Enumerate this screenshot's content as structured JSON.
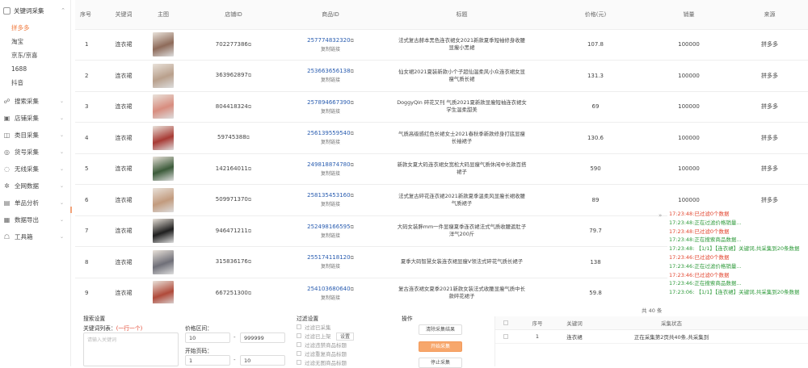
{
  "sidebar": {
    "head_label": "关键词采集",
    "subs": [
      "拼多多",
      "淘宝",
      "京东/京喜",
      "1688",
      "抖音"
    ],
    "active_sub": 0,
    "items": [
      {
        "label": "搜索采集",
        "icon": "☍"
      },
      {
        "label": "店铺采集",
        "icon": "▣"
      },
      {
        "label": "类目采集",
        "icon": "◫"
      },
      {
        "label": "货号采集",
        "icon": "◎"
      },
      {
        "label": "无线采集",
        "icon": "◌"
      },
      {
        "label": "全网数据",
        "icon": "✲"
      },
      {
        "label": "单品分析",
        "icon": "▤"
      },
      {
        "label": "数据导出",
        "icon": "▦"
      },
      {
        "label": "工具箱",
        "icon": "☖"
      }
    ]
  },
  "table": {
    "headers": [
      "序号",
      "关键词",
      "主图",
      "店铺ID",
      "商品ID",
      "标题",
      "价格(元)",
      "销量",
      "来源"
    ],
    "rows": [
      {
        "seq": "1",
        "keyword": "连衣裙",
        "shop_id": "702277386",
        "goods_id": "257774832320",
        "goods_sub": "复制链接",
        "title": "法式复古赫本黑色连衣裙女2021新款夏季短袖修身收腰显瘦小黑裙",
        "price": "107.8",
        "sales": "100000",
        "source": "拼多多",
        "thumb": "#8e6b5a"
      },
      {
        "seq": "2",
        "keyword": "连衣裙",
        "shop_id": "363962897",
        "goods_id": "253663656138",
        "goods_sub": "复制链接",
        "title": "仙女裙2021夏装新款小个子超仙温柔风小众连衣裙女显瘦气质长裙",
        "price": "131.3",
        "sales": "100000",
        "source": "拼多多",
        "thumb": "#b9a08c"
      },
      {
        "seq": "3",
        "keyword": "连衣裙",
        "shop_id": "804418324",
        "goods_id": "257894667390",
        "goods_sub": "复制链接",
        "title": "DoggyQin 碎花又刊 气质2021夏新款显瘦短袖连衣裙女学生温柔甜美",
        "price": "69",
        "sales": "100000",
        "source": "拼多多",
        "thumb": "#d88d7f"
      },
      {
        "seq": "4",
        "keyword": "连衣裙",
        "shop_id": "59745388",
        "goods_id": "256139559540",
        "goods_sub": "复制链接",
        "title": "气质高级感红色长裙女士2021春秋季新款修身打底显瘦长袖裙子",
        "price": "130.6",
        "sales": "100000",
        "source": "拼多多",
        "thumb": "#a83b35"
      },
      {
        "seq": "5",
        "keyword": "连衣裙",
        "shop_id": "142164011",
        "goods_id": "249818874780",
        "goods_sub": "复制链接",
        "title": "新款女夏大码连衣裙女宽松大码显瘦气质休闲中长款百搭裙子",
        "price": "590",
        "sales": "100000",
        "source": "拼多多",
        "thumb": "#3c5b3a"
      },
      {
        "seq": "6",
        "keyword": "连衣裙",
        "shop_id": "509971370",
        "goods_id": "258135453160",
        "goods_sub": "复制链接",
        "title": "法式复古碎花连衣裙2021新款夏季温柔风显瘦长裙收腰气质裙子",
        "price": "89",
        "sales": "100000",
        "source": "拼多多",
        "thumb": "#c29b7e"
      },
      {
        "seq": "7",
        "keyword": "连衣裙",
        "shop_id": "946471211",
        "goods_id": "252498166595",
        "goods_sub": "复制链接",
        "title": "大码女装胖mm一件显瘦夏季连衣裙法式气质收腰遮肚子洋气200斤",
        "price": "79.7",
        "sales": "100000",
        "source": "拼多多",
        "thumb": "#1f1f1f"
      },
      {
        "seq": "8",
        "keyword": "连衣裙",
        "shop_id": "315836176",
        "goods_id": "255174118120",
        "goods_sub": "复制链接",
        "title": "夏季大码智慧女装连衣裙显瘦V领法式碎花气质长裙子",
        "price": "138",
        "sales": "100000",
        "source": "拼多多",
        "thumb": "#6f6f78"
      },
      {
        "seq": "9",
        "keyword": "连衣裙",
        "shop_id": "667251300",
        "goods_id": "254103680640",
        "goods_sub": "复制链接",
        "title": "复古连衣裙女夏季2021新款女装法式收腰显瘦气质中长款碎花裙子",
        "price": "59.8",
        "sales": "100000",
        "source": "拼多多",
        "thumb": "#b04a3a"
      }
    ]
  },
  "log": [
    {
      "text": "17:23:48:已过滤0个数据",
      "color": "#e2452f"
    },
    {
      "text": "17:23:48:正在过滤价格销量...",
      "color": "#2e9a3a"
    },
    {
      "text": "17:23:48:已过滤0个数据",
      "color": "#e2452f"
    },
    {
      "text": "17:23:48:正在搜索商品数据...",
      "color": "#2e9a3a"
    },
    {
      "text": "17:23:48: 【1/1】【连衣裙】关键词,共采集到20条数据",
      "color": "#2e9a3a"
    },
    {
      "text": "17:23:46:已过滤0个数据",
      "color": "#e2452f"
    },
    {
      "text": "17:23:46:正在过滤价格销量...",
      "color": "#2e9a3a"
    },
    {
      "text": "17:23:46:已过滤0个数据",
      "color": "#e2452f"
    },
    {
      "text": "17:23:46:正在搜索商品数据...",
      "color": "#2e9a3a"
    },
    {
      "text": "17:23:06: 【1/1】【连衣裙】关键词,共采集到20条数据",
      "color": "#2e9a3a"
    }
  ],
  "pager_text": "共 40 条",
  "bottom": {
    "search_title": "搜索设置",
    "kw_label": "关键词列表：",
    "kw_hint": "(一行一个)",
    "kw_placeholder": "请输入关键词",
    "price_label": "价格区间：",
    "price_min": "10",
    "price_max": "999999",
    "page_label": "开始页码：",
    "page_start": "1",
    "page_end": "10",
    "filter_title": "过滤设置",
    "filters": [
      "过滤已采集",
      "过滤已上架",
      "过滤违禁商品标题",
      "过滤重复商品标题",
      "过滤无图商品标题"
    ],
    "filter_setting": "设置",
    "ops_title": "操作",
    "btn_clear": "清除采集结果",
    "btn_start": "开始采集",
    "btn_stop": "停止采集",
    "mini_headers": [
      "序号",
      "关键词",
      "采集状态"
    ],
    "mini_row": {
      "seq": "1",
      "keyword": "连衣裙",
      "status": "正在采集第2页共40条,共采集到"
    }
  }
}
